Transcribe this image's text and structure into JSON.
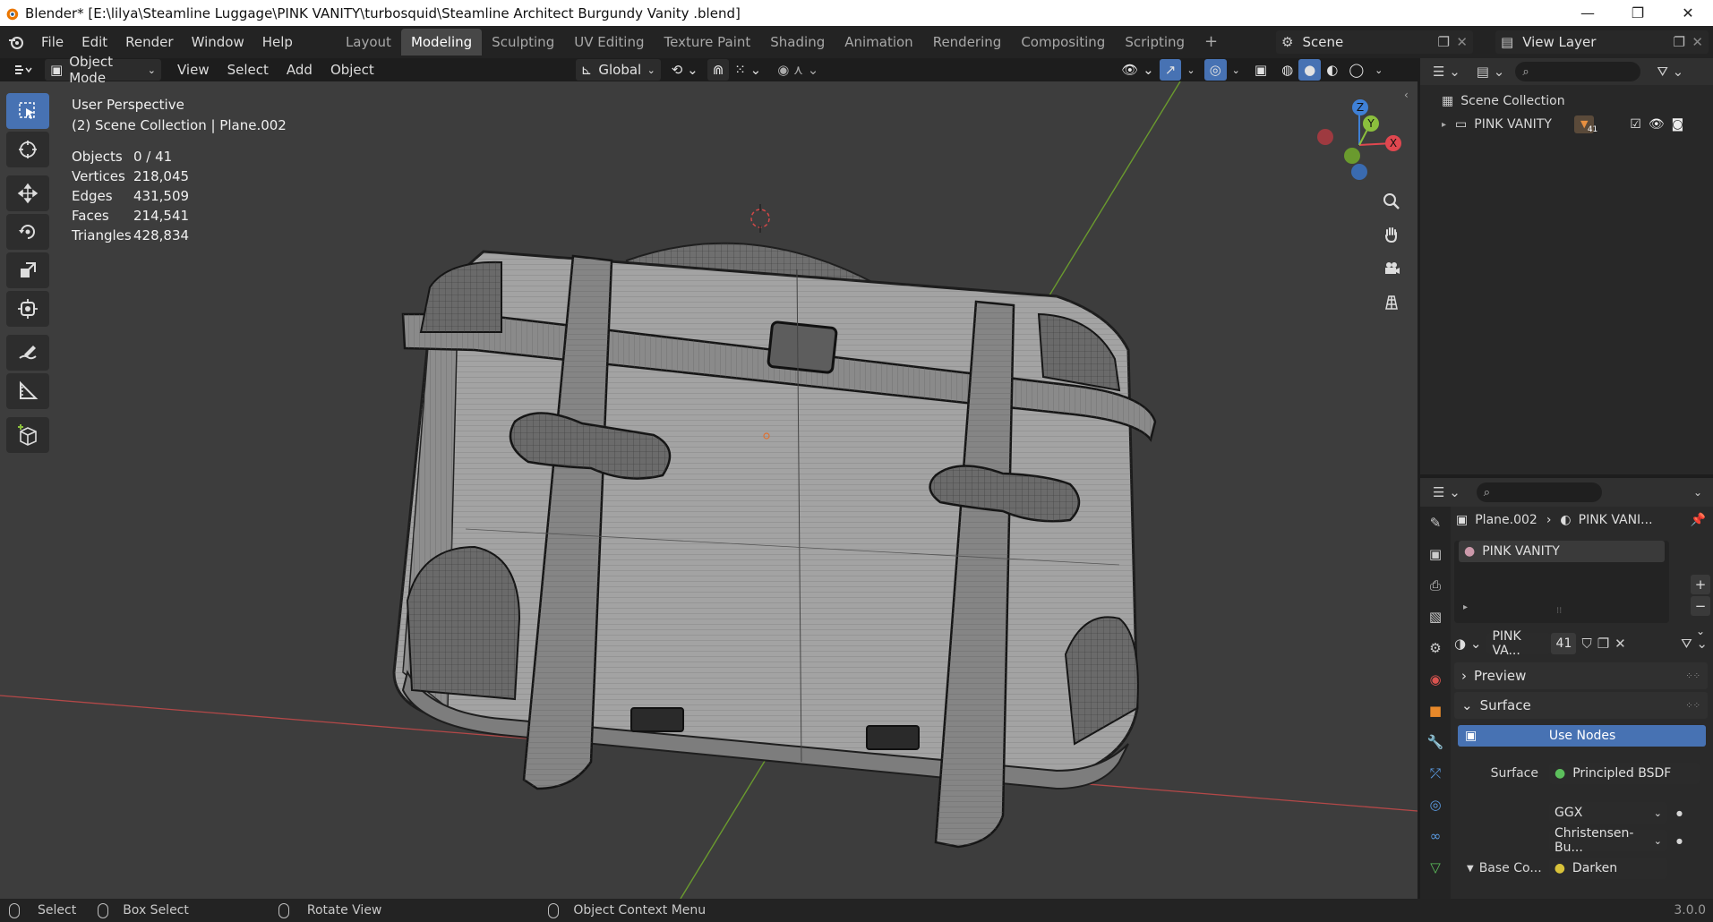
{
  "window": {
    "title": "Blender* [E:\\lilya\\Steamline Luggage\\PINK VANITY\\turbosquid\\Steamline Architect Burgundy Vanity .blend]",
    "minimize": "—",
    "restore": "❐",
    "close": "✕"
  },
  "menu": [
    "File",
    "Edit",
    "Render",
    "Window",
    "Help"
  ],
  "workspaces": [
    "Layout",
    "Modeling",
    "Sculpting",
    "UV Editing",
    "Texture Paint",
    "Shading",
    "Animation",
    "Rendering",
    "Compositing",
    "Scripting"
  ],
  "active_workspace": "Modeling",
  "scene": {
    "name": "Scene",
    "view_layer": "View Layer"
  },
  "viewport_header": {
    "mode": "Object Mode",
    "menus": [
      "View",
      "Select",
      "Add",
      "Object"
    ],
    "orientation": "Global"
  },
  "viewport": {
    "perspective": "User Perspective",
    "collection_info": "(2) Scene Collection | Plane.002",
    "stats": [
      {
        "label": "Objects",
        "value": "0 / 41"
      },
      {
        "label": "Vertices",
        "value": "218,045"
      },
      {
        "label": "Edges",
        "value": "431,509"
      },
      {
        "label": "Faces",
        "value": "214,541"
      },
      {
        "label": "Triangles",
        "value": "428,834"
      }
    ],
    "gizmo_axes": {
      "x": "X",
      "y": "Y",
      "z": "Z"
    }
  },
  "outliner": {
    "root": "Scene Collection",
    "items": [
      {
        "name": "PINK VANITY",
        "badge": "41"
      }
    ]
  },
  "properties": {
    "breadcrumb_object": "Plane.002",
    "breadcrumb_material": "PINK VANI...",
    "material_slot": "PINK VANITY",
    "material_name": "PINK VA...",
    "user_count": "41",
    "panels": {
      "preview": "Preview",
      "surface": "Surface"
    },
    "use_nodes": "Use Nodes",
    "surface_label": "Surface",
    "surface_value": "Principled BSDF",
    "distribution": "GGX",
    "subsurface": "Christensen-Bu...",
    "base_color_label": "Base Co...",
    "base_color_value": "Darken"
  },
  "statusbar": {
    "select": "Select",
    "box_select": "Box Select",
    "rotate": "Rotate View",
    "context": "Object Context Menu",
    "version": "3.0.0"
  },
  "colors": {
    "accent": "#4772b3",
    "viewport_bg": "#3d3d3d",
    "x_axis": "#e0474f",
    "y_axis": "#8bbf3d",
    "z_axis": "#3f80d6"
  }
}
